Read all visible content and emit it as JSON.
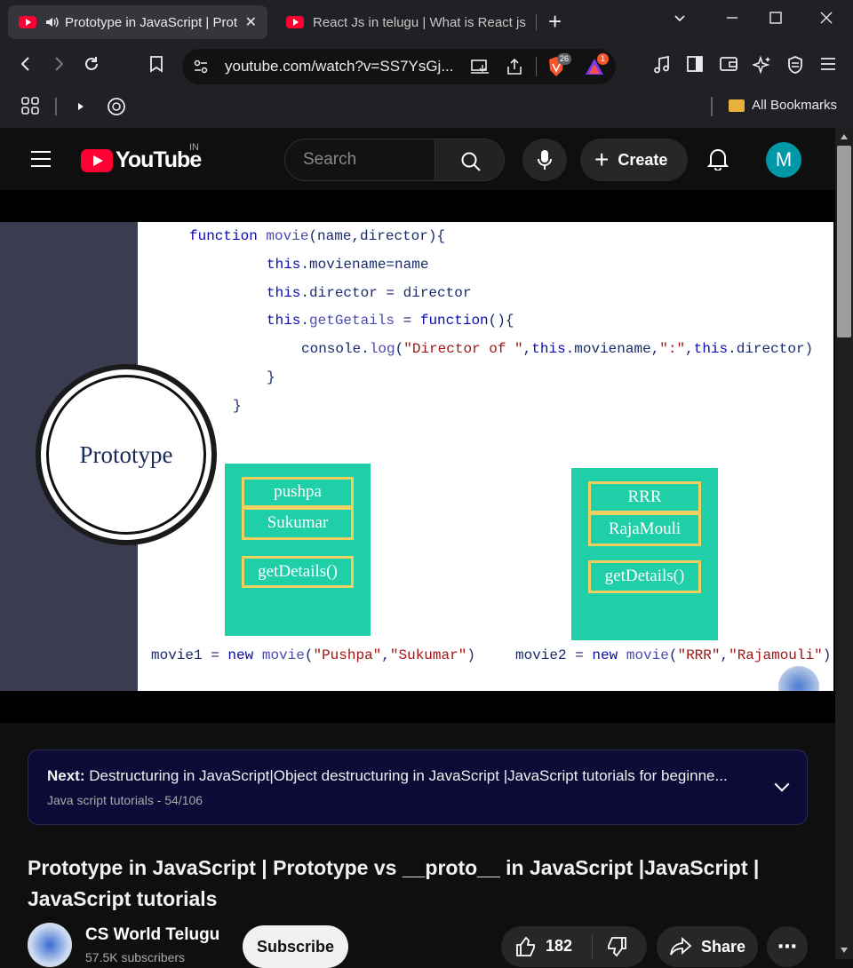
{
  "browser": {
    "tabs": [
      {
        "title": "Prototype in JavaScript | Prot",
        "active": true
      },
      {
        "title": "React Js in telugu | What is React js |",
        "active": false
      }
    ],
    "url": "youtube.com/watch?v=SS7YsGj...",
    "brave_badge": "26",
    "rewards_badge": "1",
    "bookmarks_all": "All Bookmarks"
  },
  "youtube": {
    "logo_text": "YouTube",
    "country_code": "IN",
    "search_placeholder": "Search",
    "create_label": "Create",
    "avatar_initial": "M"
  },
  "video_slide": {
    "prototype_label": "Prototype",
    "code_lines": [
      "function movie(name,director){",
      "this.moviename=name",
      "this.director = director",
      "this.getGetails = function(){",
      "console.log(\"Director of \",this.moviename,\":\",this.director)",
      "}",
      "}"
    ],
    "object1": {
      "name": "pushpa",
      "director": "Sukumar",
      "method": "getDetails()"
    },
    "object2": {
      "name": "RRR",
      "director": "RajaMouli",
      "method": "getDetails()"
    },
    "instance1": "movie1 = new movie(\"Pushpa\",\"Sukumar\")",
    "instance2": "movie2 = new movie(\"RRR\",\"Rajamouli\")"
  },
  "next": {
    "label": "Next:",
    "title": "Destructuring in JavaScript|Object destructuring in JavaScript |JavaScript tutorials for beginne...",
    "playlist": "Java script tutorials - 54/106"
  },
  "video": {
    "title": "Prototype in JavaScript | Prototype vs __proto__ in JavaScript |JavaScript | JavaScript tutorials",
    "channel_name": "CS World Telugu",
    "subscribers": "57.5K subscribers",
    "subscribe_label": "Subscribe",
    "likes": "182",
    "share_label": "Share"
  }
}
